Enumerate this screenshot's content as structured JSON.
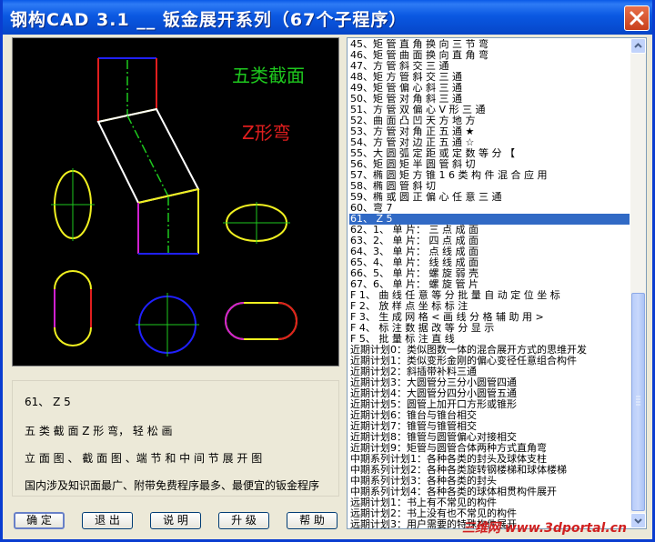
{
  "window": {
    "title": "钢构CAD 3.1 __ 钣金展开系列（67个子程序）"
  },
  "preview": {
    "label1": "五类截面",
    "label2": "Z形弯",
    "label1_color": "#1EC81E",
    "label2_color": "#E01E1E"
  },
  "description": {
    "line1": "61、 Z 5",
    "line2": "五 类 截 面 Z 形 弯， 轻 松 画",
    "line3": "立 面 图 、 截 面  图 、端 节 和 中 间 节 展 开 图",
    "line4": "国内涉及知识面最广、附带免费程序最多、最便宜的钣金程序"
  },
  "list": {
    "selected_index": 16,
    "items": [
      "45、矩 管 直 角 换 向 三 节 弯",
      "46、矩 管 曲 面 换 向 直 角 弯",
      "47、方 管 斜 交 三 通",
      "48、矩 方 管 斜 交 三 通",
      "49、矩 管 偏 心 斜 三 通",
      "50、矩 管 对 角 斜 三 通",
      "51、方 管 双 偏 心 V 形 三 通",
      "52、曲 面 凸 凹 天 方 地 方",
      "53、方 管 对   角   正 五 通  ★",
      "54、方 管 对   边   正 五 通  ☆",
      "55、大 圆 弧 定 距 或 定 数 等 分 【",
      "56、矩 圆 矩 半 圆 管 斜 切",
      "57、椭 圆 矩 方 锥 1 6 类 构 件 混 合 应 用",
      "58、椭 圆 管 斜 切",
      "59、椭 或 圆 正 偏 心 任 意 三 通",
      "60、弯   7",
      "61、 Z  5",
      "62、1、  单 片：  三 点 成 面",
      "63、2、  单 片：  四 点 成 面",
      "64、3、  单 片：  点 线 成 面",
      "65、4、  单 片：  线 线 成 面",
      "66、5、  单 片：  螺 旋 弱 壳",
      "67、6、  单 片：  螺 旋 管 片",
      "  F 1、  曲 线 任 意 等 分 批 量 自 动 定 位 坐 标",
      "  F 2、  放 样 点 坐 标 标 注",
      "  F 3、  生 成 网 格 < 画 线 分 格 辅 助 用 >",
      "  F 4、  标 注 数 据 改 等 分 显 示",
      "  F 5、  批 量 标 注 直 线",
      "近期计划0：类似图数一体的混合展开方式的思维开发",
      "近期计划1：类似变形金刚的偏心变径任意组合构件",
      "近期计划2：斜插带补料三通",
      "近期计划3：大圆管分三分小圆管四通",
      "近期计划4：大圆管分四分小圆管五通",
      "近期计划5：圆管上加开口方形或锥形",
      "近期计划6：锥台与锥台相交",
      "近期计划7：锥管与锥管相交",
      "近期计划8：锥管与圆管偏心对接相交",
      "近期计划9：矩管与圆管合体两种方式直角弯",
      "中期系列计划1：各种各类的封头及球体支柱",
      "中期系列计划2：各种各类旋转钢楼梯和球体楼梯",
      "中期系列计划3：各种各类的封头",
      "中期系列计划4：各种各类的球体相贯构件展开",
      "远期计划1：书上有不常见的构件",
      "远期计划2：书上没有也不常见的构件",
      "远期计划3：用户需要的特殊构件展开"
    ]
  },
  "buttons": {
    "ok": "确 定",
    "exit": "退 出",
    "help_text": "说 明",
    "upgrade": "升 级",
    "help": "帮 助"
  },
  "watermark": "三维网 www.3dportal.cn"
}
